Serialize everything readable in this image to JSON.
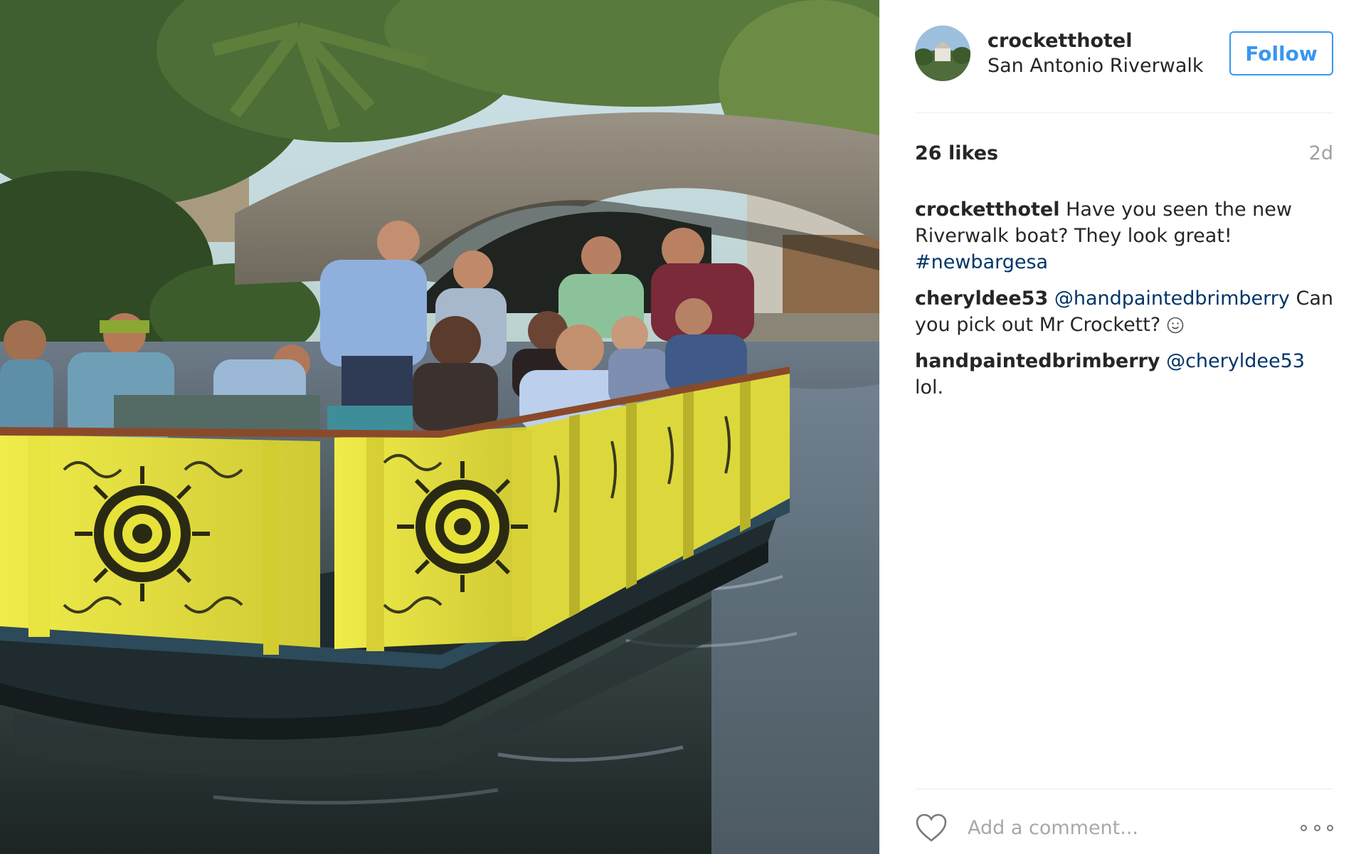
{
  "post": {
    "username": "crocketthotel",
    "location": "San Antonio Riverwalk",
    "follow_label": "Follow",
    "likes": "26 likes",
    "age": "2d",
    "add_comment_placeholder": "Add a comment...",
    "like_icon": "heart-icon",
    "more_icon": "more-options-icon"
  },
  "caption": {
    "user": "crocketthotel",
    "text": "Have you seen the new Riverwalk boat? They look great!",
    "hashtag": "#newbargesa"
  },
  "comments": [
    {
      "user": "cheryldee53",
      "mention": "@handpaintedbrimberry",
      "text": "Can you pick out Mr Crockett?",
      "emoji": "smiley-face"
    },
    {
      "user": "handpaintedbrimberry",
      "mention": "@cheryldee53",
      "text": "lol."
    }
  ],
  "colors": {
    "follow_blue": "#3897f0",
    "link_navy": "#003569",
    "text_dark": "#262626",
    "muted_gray": "#a0a0a0",
    "boat_yellow": "#e6e23a"
  }
}
